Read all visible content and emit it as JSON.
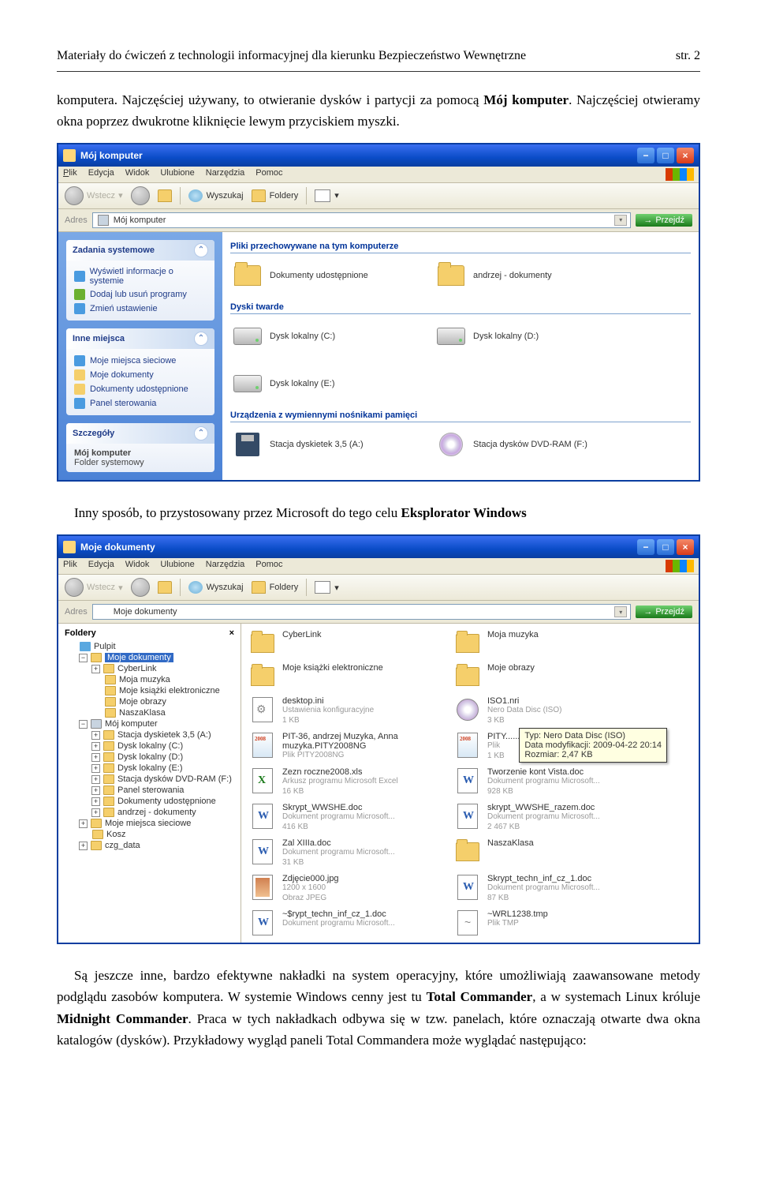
{
  "page_header": {
    "left": "Materiały do ćwiczeń z technologii informacyjnej dla kierunku Bezpieczeństwo Wewnętrzne",
    "right": "str. 2"
  },
  "para1_a": "komputera. Najczęściej używany, to otwieranie dysków i partycji za pomocą ",
  "para1_b": "Mój komputer",
  "para1_c": ". Najczęściej otwieramy okna poprzez dwukrotne kliknięcie lewym przyciskiem myszki.",
  "para2_a": "Inny sposób, to przystosowany przez Microsoft do tego celu ",
  "para2_b": "Eksplorator Windows",
  "para3_a": "Są jeszcze inne, bardzo efektywne nakładki na system operacyjny, które umożliwiają zaawansowane metody podglądu zasobów komputera. W systemie Windows cenny jest tu ",
  "para3_b": "Total Commander",
  "para3_c": ", a w systemach Linux króluje ",
  "para3_d": "Midnight Commander",
  "para3_e": ". Praca w tych nakładkach odbywa się w tzw. panelach, które oznaczają otwarte dwa okna katalogów (dysków). Przykładowy wygląd paneli Total Commandera może wyglądać następująco:",
  "ss1": {
    "title": "Mój komputer",
    "menu": {
      "plik": "Plik",
      "edycja": "Edycja",
      "widok": "Widok",
      "ulubione": "Ulubione",
      "narzedzia": "Narzędzia",
      "pomoc": "Pomoc"
    },
    "toolbar": {
      "wstecz": "Wstecz",
      "wyszukaj": "Wyszukaj",
      "foldery": "Foldery"
    },
    "address_label": "Adres",
    "address_value": "Mój komputer",
    "go": "Przejdź",
    "panels": {
      "tasks": {
        "title": "Zadania systemowe",
        "items": [
          "Wyświetl informacje o systemie",
          "Dodaj lub usuń programy",
          "Zmień ustawienie"
        ]
      },
      "places": {
        "title": "Inne miejsca",
        "items": [
          "Moje miejsca sieciowe",
          "Moje dokumenty",
          "Dokumenty udostępnione",
          "Panel sterowania"
        ]
      },
      "details": {
        "title": "Szczegóły",
        "name": "Mój komputer",
        "type": "Folder systemowy"
      }
    },
    "sections": {
      "files": {
        "title": "Pliki przechowywane na tym komputerze",
        "items": [
          "Dokumenty udostępnione",
          "andrzej - dokumenty"
        ]
      },
      "drives": {
        "title": "Dyski twarde",
        "items": [
          "Dysk lokalny (C:)",
          "Dysk lokalny (D:)",
          "Dysk lokalny (E:)"
        ]
      },
      "removable": {
        "title": "Urządzenia z wymiennymi nośnikami pamięci",
        "items": [
          "Stacja dyskietek 3,5 (A:)",
          "Stacja dysków DVD-RAM (F:)"
        ]
      }
    }
  },
  "ss2": {
    "title": "Moje dokumenty",
    "menu": {
      "plik": "Plik",
      "edycja": "Edycja",
      "widok": "Widok",
      "ulubione": "Ulubione",
      "narzedzia": "Narzędzia",
      "pomoc": "Pomoc"
    },
    "toolbar": {
      "wstecz": "Wstecz",
      "wyszukaj": "Wyszukaj",
      "foldery": "Foldery"
    },
    "address_label": "Adres",
    "address_value": "Moje dokumenty",
    "go": "Przejdź",
    "folders_head": "Foldery",
    "tree": [
      {
        "indent": 0,
        "exp": "",
        "icon": "desk",
        "label": "Pulpit"
      },
      {
        "indent": 1,
        "exp": "−",
        "icon": "fold",
        "label": "Moje dokumenty",
        "sel": true
      },
      {
        "indent": 2,
        "exp": "+",
        "icon": "fold",
        "label": "CyberLink"
      },
      {
        "indent": 2,
        "exp": "",
        "icon": "fold",
        "label": "Moja muzyka"
      },
      {
        "indent": 2,
        "exp": "",
        "icon": "fold",
        "label": "Moje książki elektroniczne"
      },
      {
        "indent": 2,
        "exp": "",
        "icon": "fold",
        "label": "Moje obrazy"
      },
      {
        "indent": 2,
        "exp": "",
        "icon": "fold",
        "label": "NaszaKlasa"
      },
      {
        "indent": 1,
        "exp": "−",
        "icon": "comp",
        "label": "Mój komputer"
      },
      {
        "indent": 2,
        "exp": "+",
        "icon": "fold",
        "label": "Stacja dyskietek 3,5 (A:)"
      },
      {
        "indent": 2,
        "exp": "+",
        "icon": "fold",
        "label": "Dysk lokalny (C:)"
      },
      {
        "indent": 2,
        "exp": "+",
        "icon": "fold",
        "label": "Dysk lokalny (D:)"
      },
      {
        "indent": 2,
        "exp": "+",
        "icon": "fold",
        "label": "Dysk lokalny (E:)"
      },
      {
        "indent": 2,
        "exp": "+",
        "icon": "fold",
        "label": "Stacja dysków DVD-RAM (F:)"
      },
      {
        "indent": 2,
        "exp": "+",
        "icon": "fold",
        "label": "Panel sterowania"
      },
      {
        "indent": 2,
        "exp": "+",
        "icon": "fold",
        "label": "Dokumenty udostępnione"
      },
      {
        "indent": 2,
        "exp": "+",
        "icon": "fold",
        "label": "andrzej - dokumenty"
      },
      {
        "indent": 1,
        "exp": "+",
        "icon": "fold",
        "label": "Moje miejsca sieciowe"
      },
      {
        "indent": 1,
        "exp": "",
        "icon": "fold",
        "label": "Kosz"
      },
      {
        "indent": 1,
        "exp": "+",
        "icon": "fold",
        "label": "czg_data"
      }
    ],
    "files": [
      {
        "ico": "folder",
        "name": "CyberLink",
        "sub": ""
      },
      {
        "ico": "folder",
        "name": "Moja muzyka",
        "sub": ""
      },
      {
        "ico": "folder",
        "name": "Moje książki elektroniczne",
        "sub": ""
      },
      {
        "ico": "folder",
        "name": "Moje obrazy",
        "sub": ""
      },
      {
        "ico": "ini",
        "name": "desktop.ini",
        "sub": "Ustawienia konfiguracyjne\n1 KB"
      },
      {
        "ico": "iso",
        "name": "ISO1.nri",
        "sub": "Nero Data Disc (ISO)\n3 KB"
      },
      {
        "ico": "pit",
        "name": "PIT-36, andrzej Muzyka, Anna muzyka.PITY2008NG",
        "sub": "Plik PITY2008NG"
      },
      {
        "ico": "pit",
        "name": "PITY.........",
        "sub": "Plik\n1 KB"
      },
      {
        "ico": "xls",
        "name": "Zezn roczne2008.xls",
        "sub": "Arkusz programu Microsoft Excel\n16 KB"
      },
      {
        "ico": "doc",
        "name": "Tworzenie kont Vista.doc",
        "sub": "Dokument programu Microsoft...\n928 KB"
      },
      {
        "ico": "doc",
        "name": "Skrypt_WWSHE.doc",
        "sub": "Dokument programu Microsoft...\n416 KB"
      },
      {
        "ico": "doc",
        "name": "skrypt_WWSHE_razem.doc",
        "sub": "Dokument programu Microsoft...\n2 467 KB"
      },
      {
        "ico": "doc",
        "name": "Zal XIIIa.doc",
        "sub": "Dokument programu Microsoft...\n31 KB"
      },
      {
        "ico": "folder",
        "name": "NaszaKlasa",
        "sub": ""
      },
      {
        "ico": "img",
        "name": "Zdjęcie000.jpg",
        "sub": "1200 x 1600\nObraz JPEG"
      },
      {
        "ico": "doc",
        "name": "Skrypt_techn_inf_cz_1.doc",
        "sub": "Dokument programu Microsoft...\n87 KB"
      },
      {
        "ico": "doc",
        "name": "~$rypt_techn_inf_cz_1.doc",
        "sub": "Dokument programu Microsoft..."
      },
      {
        "ico": "tmp",
        "name": "~WRL1238.tmp",
        "sub": "Plik TMP"
      }
    ],
    "tooltip": {
      "l1": "Typ: Nero Data Disc (ISO)",
      "l2": "Data modyfikacji: 2009-04-22 20:14",
      "l3": "Rozmiar: 2,47 KB"
    }
  }
}
